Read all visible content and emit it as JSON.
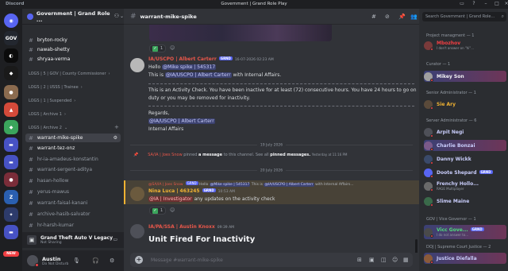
{
  "titlebar": {
    "app": "Discord",
    "title": "Government | Grand Role Play"
  },
  "rail": {
    "new_badge": "NEW"
  },
  "guild": {
    "name": "Government | Grand Role ...",
    "chevron": "⌄"
  },
  "channels": [
    {
      "name": "bryton-rocky"
    },
    {
      "name": "nawab-shetty"
    },
    {
      "name": "shryaa-verma"
    },
    {
      "name": "LOGS | 5 | GOV | County Commissioner",
      "category": true
    },
    {
      "name": "LOGS | 2 | USSS | Trainee",
      "category": true
    },
    {
      "name": "LOGS | 1 | Suspended",
      "category": true
    },
    {
      "name": "LOGS | Archive 1",
      "category": true
    },
    {
      "name": "LOGS | Archive 2",
      "category": true
    },
    {
      "name": "warrant-mike-spike",
      "active": true
    },
    {
      "name": "warrant-tez-onz"
    },
    {
      "name": "hr-ia-amadeus-konstantin"
    },
    {
      "name": "warrant-sergent-aditya"
    },
    {
      "name": "hasan-hollow"
    },
    {
      "name": "yerus-mawus"
    },
    {
      "name": "warrant-faisal-kanani"
    },
    {
      "name": "archive-hasib-salvator"
    },
    {
      "name": "hr-harsh-kumar"
    }
  ],
  "activity": {
    "game": "Grand Theft Auto V Legacy",
    "sub": "Not Sharing"
  },
  "user": {
    "name": "Austin",
    "status": "Do Not Disturb"
  },
  "header": {
    "channel": "warrant-mike-spike"
  },
  "messages": {
    "reaction1": "1",
    "m1_author": "IA/USCPO | Albert Carterr",
    "m1_tag": "GRND",
    "m1_time": "16-07-2026 02:23 AM",
    "m1_hello": "Hello",
    "m1_mention1": "@Mike spike | 545317",
    "m1_this_is": "This is",
    "m1_mention2": "@IA/USCPO | Albert Carterr",
    "m1_with": "with Internal Affairs.",
    "m1_body1": "This is an Activity Check. You have been inactive for at least (72) consecutive hours. You have 24 hours to go on",
    "m1_body2": "duty or you may be removed for inactivity.",
    "m1_regards": "Regards,",
    "m1_sig": "@IA/USCPO | Albert Carterr",
    "m1_dept": "Internal Affairs",
    "date1": "19 July 2026",
    "pin_user": "SA/IA | Joes Snow",
    "pin_text": "pinned",
    "pin_link": "a message",
    "pin_rest": "to this channel. See all",
    "pin_all": "pinned messages.",
    "pin_time": "Yesterday at 11:16 PM",
    "date2": "20 July 2026",
    "reply_author": "@SA/IA | Joes Snow",
    "reply_tag": "GRND",
    "reply_text": "Hello",
    "reply_mention": "@Mike spike | 545317",
    "reply_text2": "This is",
    "reply_mention2": "@IA/USCPO | Albert Carterr",
    "reply_text3": "with Internal Affairs...",
    "m2_author": "Nina Luca | 463245",
    "m2_tag": "GRND",
    "m2_time": "10:53 AM",
    "m2_mention": "@IA | Investigator",
    "m2_body": "any updates on the activity check",
    "reaction2": "1",
    "m3_author": "IA/PA/SSA | Austin Knoxx",
    "m3_time": "09:39 AM",
    "m3_title": "Unit Fired For Inactivity"
  },
  "input": {
    "placeholder": "Message #warrant-mike-spike"
  },
  "members": {
    "search_placeholder": "Search Government | Grand Role...",
    "groups": [
      {
        "role": "Project managment — 1"
      },
      {
        "role": "Curator — 1"
      },
      {
        "role": "Senior Administrator — 1"
      },
      {
        "role": "Server Administrator — 6"
      },
      {
        "role": "GOV | Vice Governor — 1"
      },
      {
        "role": "DOJ | Supreme Court Justice — 2"
      }
    ],
    "people": [
      {
        "name": "Mbozhov",
        "sub": "I don't answer on \"hi\"...",
        "color": "#f23f43"
      },
      {
        "name": "Mikey Son",
        "color": "#f2f3f5"
      },
      {
        "name": "Sie Ary",
        "color": "#f0b232"
      },
      {
        "name": "Arpit Negi",
        "color": "#c9cdfb"
      },
      {
        "name": "Charlie Bonzai",
        "color": "#c9cdfb"
      },
      {
        "name": "Danny Wickk",
        "color": "#c9cdfb"
      },
      {
        "name": "Doote Shepard",
        "color": "#c9cdfb",
        "tag": "GRND"
      },
      {
        "name": "Frenchy Hollo...",
        "sub": "RAGE Multiplayer",
        "color": "#c9cdfb"
      },
      {
        "name": "Slime Maine",
        "color": "#c9cdfb"
      },
      {
        "name": "Vicc Gove...",
        "sub": "I do not answer to...",
        "color": "#4fdc7c",
        "tag": "GRND"
      },
      {
        "name": "Justice Diefalla",
        "color": "#c9cdfb"
      }
    ]
  }
}
